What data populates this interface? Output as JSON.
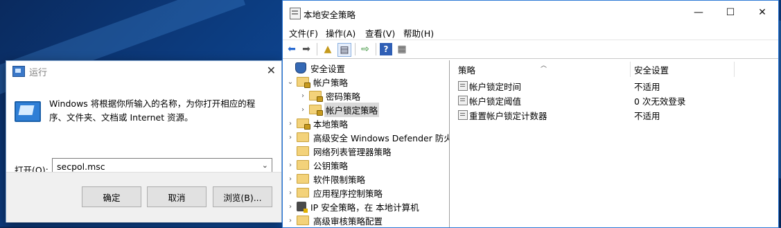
{
  "run_dialog": {
    "title": "运行",
    "description": "Windows 将根据你所输入的名称，为你打开相应的程序、文件夹、文档或 Internet 资源。",
    "open_label": "打开(O):",
    "command_value": "secpol.msc",
    "ok_label": "确定",
    "cancel_label": "取消",
    "browse_label": "浏览(B)..."
  },
  "mmc": {
    "title": "本地安全策略",
    "menu": [
      "文件(F)",
      "操作(A)",
      "查看(V)",
      "帮助(H)"
    ],
    "tree": [
      {
        "label": "安全设置",
        "chev": "",
        "icon": "shield-icon"
      },
      {
        "label": "帐户策略",
        "chev": "⌄",
        "icon": "folder-lock-icon"
      },
      {
        "label": "密码策略",
        "chev": "›",
        "icon": "folder-lock-icon"
      },
      {
        "label": "帐户锁定策略",
        "chev": "›",
        "icon": "folder-lock-icon"
      },
      {
        "label": "本地策略",
        "chev": "›",
        "icon": "folder-lock-icon"
      },
      {
        "label": "高级安全 Windows Defender 防火墙",
        "chev": "›",
        "icon": "folder-icon"
      },
      {
        "label": "网络列表管理器策略",
        "chev": "",
        "icon": "folder-icon"
      },
      {
        "label": "公钥策略",
        "chev": "›",
        "icon": "folder-icon"
      },
      {
        "label": "软件限制策略",
        "chev": "›",
        "icon": "folder-icon"
      },
      {
        "label": "应用程序控制策略",
        "chev": "›",
        "icon": "folder-icon"
      },
      {
        "label": "IP 安全策略，在 本地计算机",
        "chev": "›",
        "icon": "ip-security-icon"
      },
      {
        "label": "高级审核策略配置",
        "chev": "›",
        "icon": "folder-icon"
      }
    ],
    "columns": {
      "policy": "策略",
      "setting": "安全设置"
    },
    "rows": [
      {
        "policy": "帐户锁定时间",
        "setting": "不适用"
      },
      {
        "policy": "帐户锁定阈值",
        "setting": "0 次无效登录"
      },
      {
        "policy": "重置帐户锁定计数器",
        "setting": "不适用"
      }
    ]
  }
}
